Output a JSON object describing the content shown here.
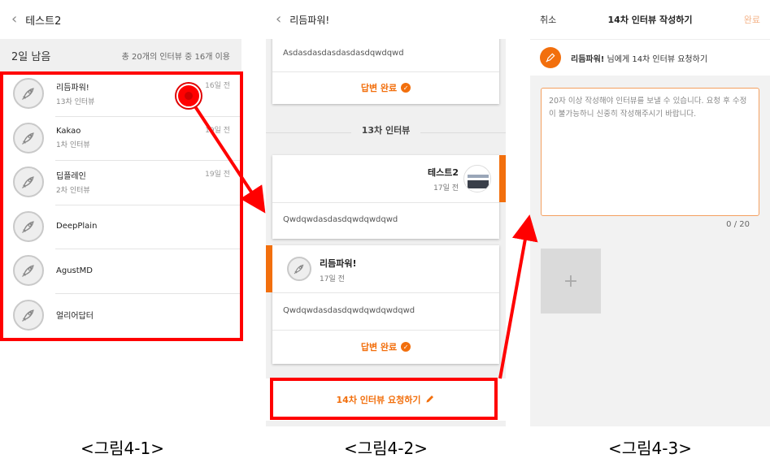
{
  "colors": {
    "accent": "#f26f0d",
    "annotation": "#ff0000"
  },
  "panel1": {
    "header_title": "테스트2",
    "days_left": "2일 남음",
    "usage": "총 20개의 인터뷰 중 16개 이용",
    "rows": [
      {
        "name": "리듬파워!",
        "sub": "13차 인터뷰",
        "date": "16일 전"
      },
      {
        "name": "Kakao",
        "sub": "1차 인터뷰",
        "date": "19일 전"
      },
      {
        "name": "딥플레인",
        "sub": "2차 인터뷰",
        "date": "19일 전"
      },
      {
        "name": "DeepPlain",
        "sub": "",
        "date": ""
      },
      {
        "name": "AgustMD",
        "sub": "",
        "date": ""
      },
      {
        "name": "얼리어답터",
        "sub": "",
        "date": ""
      }
    ]
  },
  "panel2": {
    "header_title": "리듬파워!",
    "top_answer_text": "Asdasdasdasdasdasdqwdqwd",
    "answer_done": "답변 완료",
    "section_title": "13차 인터뷰",
    "msg_right": {
      "name": "테스트2",
      "date": "17일 전",
      "text": "Qwdqwdasdasdqwdqwdqwd"
    },
    "msg_left": {
      "name": "리듬파워!",
      "date": "17일 전",
      "text": "Qwdqwdasdasdqwdqwdqwdqwd"
    },
    "request_button": "14차 인터뷰 요청하기"
  },
  "panel3": {
    "cancel": "취소",
    "title": "14차 인터뷰 작성하기",
    "done": "완료",
    "to_name": "리듬파워!",
    "to_suffix": " 님에게 14차 인터뷰 요청하기",
    "placeholder": "20자 이상 작성해야 인터뷰를 보낼 수 있습니다. 요청 후 수정이 불가능하니 신중히 작성해주시기 바랍니다.",
    "counter": "0 / 20",
    "add_symbol": "+"
  },
  "captions": [
    "<그림4-1>",
    "<그림4-2>",
    "<그림4-3>"
  ]
}
